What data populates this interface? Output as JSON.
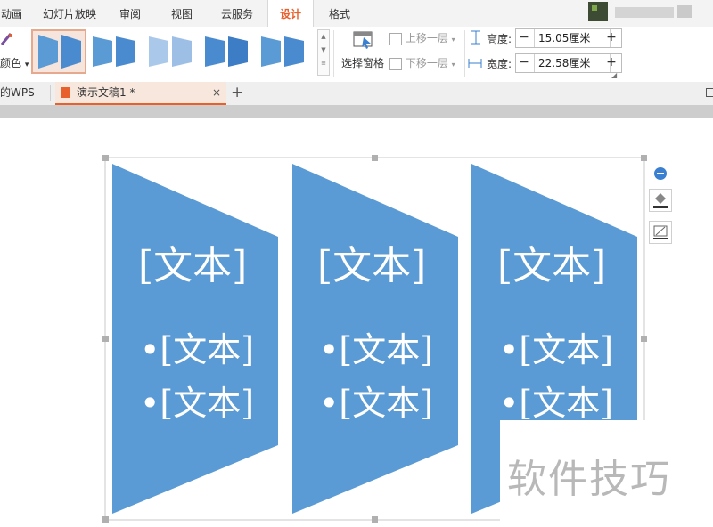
{
  "menu": {
    "tabs": [
      "动画",
      "幻灯片放映",
      "审阅",
      "视图",
      "云服务",
      "设计",
      "格式"
    ],
    "active": "设计"
  },
  "ribbon": {
    "color_label": "颜色",
    "selection_pane_label": "选择窗格",
    "bring_forward_label": "上移一层",
    "send_backward_label": "下移一层",
    "height_label": "高度:",
    "height_value": "15.05厘米",
    "width_label": "宽度:",
    "width_value": "22.58厘米",
    "minus": "−",
    "plus": "+"
  },
  "doc_tabs": {
    "partial_label": "的WPS",
    "active_label": "演示文稿1 *",
    "close": "×",
    "new_tab": "+"
  },
  "smartart": {
    "columns": [
      {
        "title": "[文本]",
        "bullets": [
          "•[文本]",
          "•[文本]"
        ]
      },
      {
        "title": "[文本]",
        "bullets": [
          "•[文本]",
          "•[文本]"
        ]
      },
      {
        "title": "[文本]",
        "bullets": [
          "•[文本]",
          "•[文本]"
        ]
      }
    ],
    "fill_color": "#5b9bd5"
  },
  "watermark": "软件技巧",
  "colors": {
    "accent_orange": "#e8602c",
    "shape_blue": "#5b9bd5"
  }
}
